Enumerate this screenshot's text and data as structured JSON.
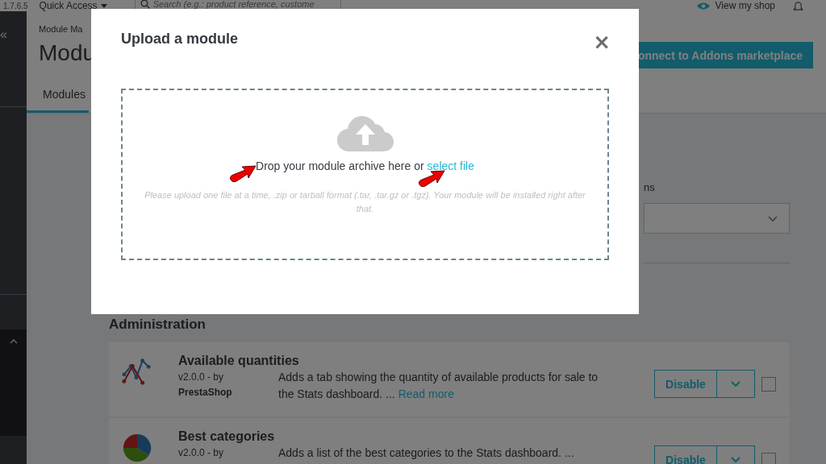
{
  "top_bar": {
    "version": "1.7.6.5",
    "quick_access": "Quick Access",
    "search": {
      "placeholder": "Search (e.g.: product reference, custome"
    },
    "view_shop": "View my shop"
  },
  "sidebar": {
    "collapse": "«"
  },
  "header": {
    "breadcrumb": "Module Ma",
    "title": "Modu",
    "connect_button": "onnect to Addons marketplace",
    "tabs": [
      {
        "label": "Modules",
        "selected": true
      }
    ]
  },
  "filters": {
    "label": "ns"
  },
  "category": {
    "title": "Administration"
  },
  "modules": [
    {
      "name": "Available quantities",
      "version": "v2.0.0 - by",
      "author": "PrestaShop",
      "description": "Adds a tab showing the quantity of available products for sale to the Stats dashboard. ...",
      "read_more": "Read more",
      "action": "Disable",
      "kind": "line-chart",
      "checked": false
    },
    {
      "name": "Best categories",
      "version": "v2.0.0 - by",
      "description": "Adds a list of the best categories to the Stats dashboard. ...",
      "action": "Disable",
      "kind": "pie-chart",
      "checked": false
    }
  ],
  "modal": {
    "title": "Upload a module",
    "close": "×",
    "drop_text": "Drop your module archive here or",
    "select_link": "select file",
    "hint": "Please upload one file at a time, .zip or tarball format (.tar, .tar.gz or .tgz). Your module will be installed right after that."
  }
}
